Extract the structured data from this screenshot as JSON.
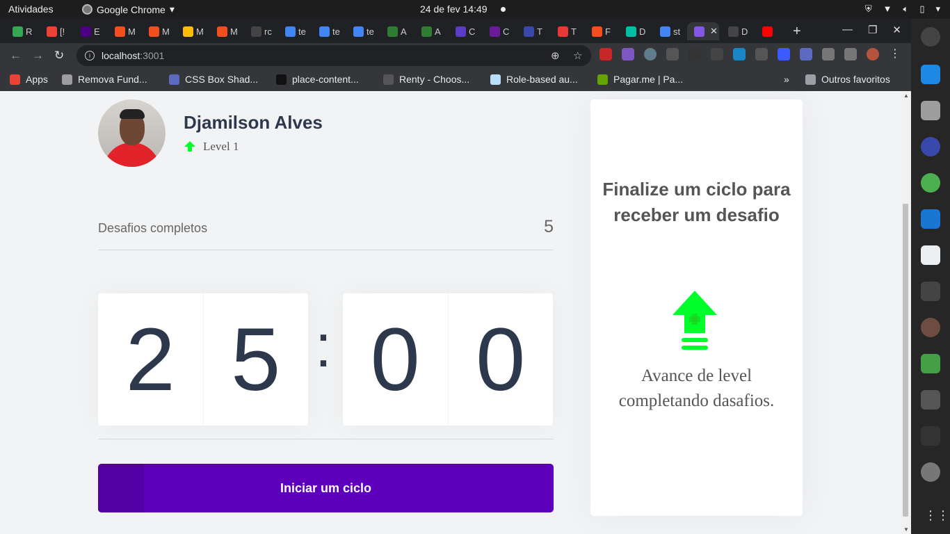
{
  "system": {
    "activities": "Atividades",
    "app_name": "Google Chrome",
    "datetime": "24 de fev  14:49"
  },
  "browser": {
    "tabs": [
      {
        "label": "R",
        "color": "#34a853"
      },
      {
        "label": "[!",
        "color": "#ea4335"
      },
      {
        "label": "E",
        "color": "#4b0082"
      },
      {
        "label": "M",
        "color": "#f24e1e"
      },
      {
        "label": "M",
        "color": "#f24e1e"
      },
      {
        "label": "M",
        "color": "#fbbc05"
      },
      {
        "label": "M",
        "color": "#f24e1e"
      },
      {
        "label": "rc",
        "color": "#444444"
      },
      {
        "label": "te",
        "color": "#4285f4"
      },
      {
        "label": "te",
        "color": "#4285f4"
      },
      {
        "label": "te",
        "color": "#4285f4"
      },
      {
        "label": "A",
        "color": "#2e7d32"
      },
      {
        "label": "A",
        "color": "#2e7d32"
      },
      {
        "label": "C",
        "color": "#5b3cc4"
      },
      {
        "label": "C",
        "color": "#6a1b9a"
      },
      {
        "label": "T",
        "color": "#3949ab"
      },
      {
        "label": "T",
        "color": "#e53935"
      },
      {
        "label": "F",
        "color": "#f24e1e"
      },
      {
        "label": "D",
        "color": "#00bfa5"
      },
      {
        "label": "st",
        "color": "#4285f4"
      },
      {
        "label": "",
        "color": "#8257e5",
        "active": true
      },
      {
        "label": "D",
        "color": "#444444"
      },
      {
        "label": "",
        "color": "#ff0000"
      }
    ],
    "url_host": "localhost",
    "url_port": ":3001",
    "bookmarks": [
      {
        "label": "Apps",
        "color": "#ea4335"
      },
      {
        "label": "Remova Fund...",
        "color": "#9e9e9e"
      },
      {
        "label": "CSS Box Shad...",
        "color": "#5c6bc0"
      },
      {
        "label": "place-content...",
        "color": "#111111"
      },
      {
        "label": "Renty - Choos...",
        "color": "#555555"
      },
      {
        "label": "Role-based au...",
        "color": "#bbdefb"
      },
      {
        "label": "Pagar.me | Pa...",
        "color": "#65a300"
      }
    ],
    "overflow": "»",
    "other_bookmarks": "Outros favoritos"
  },
  "profile": {
    "name": "Djamilson Alves",
    "level": "Level 1"
  },
  "challenges": {
    "label": "Desafios completos",
    "count": "5"
  },
  "countdown": {
    "minute_left": "2",
    "minute_right": "5",
    "separator": ":",
    "second_left": "0",
    "second_right": "0"
  },
  "start_button": "Iniciar um ciclo",
  "challenge_card": {
    "title": "Finalize um ciclo para receber um desafio",
    "message": "Avance de level completando dasafios."
  },
  "colors": {
    "primary": "#5e00bb",
    "level_green": "#00ff2a",
    "text_dark": "#2e384d"
  }
}
